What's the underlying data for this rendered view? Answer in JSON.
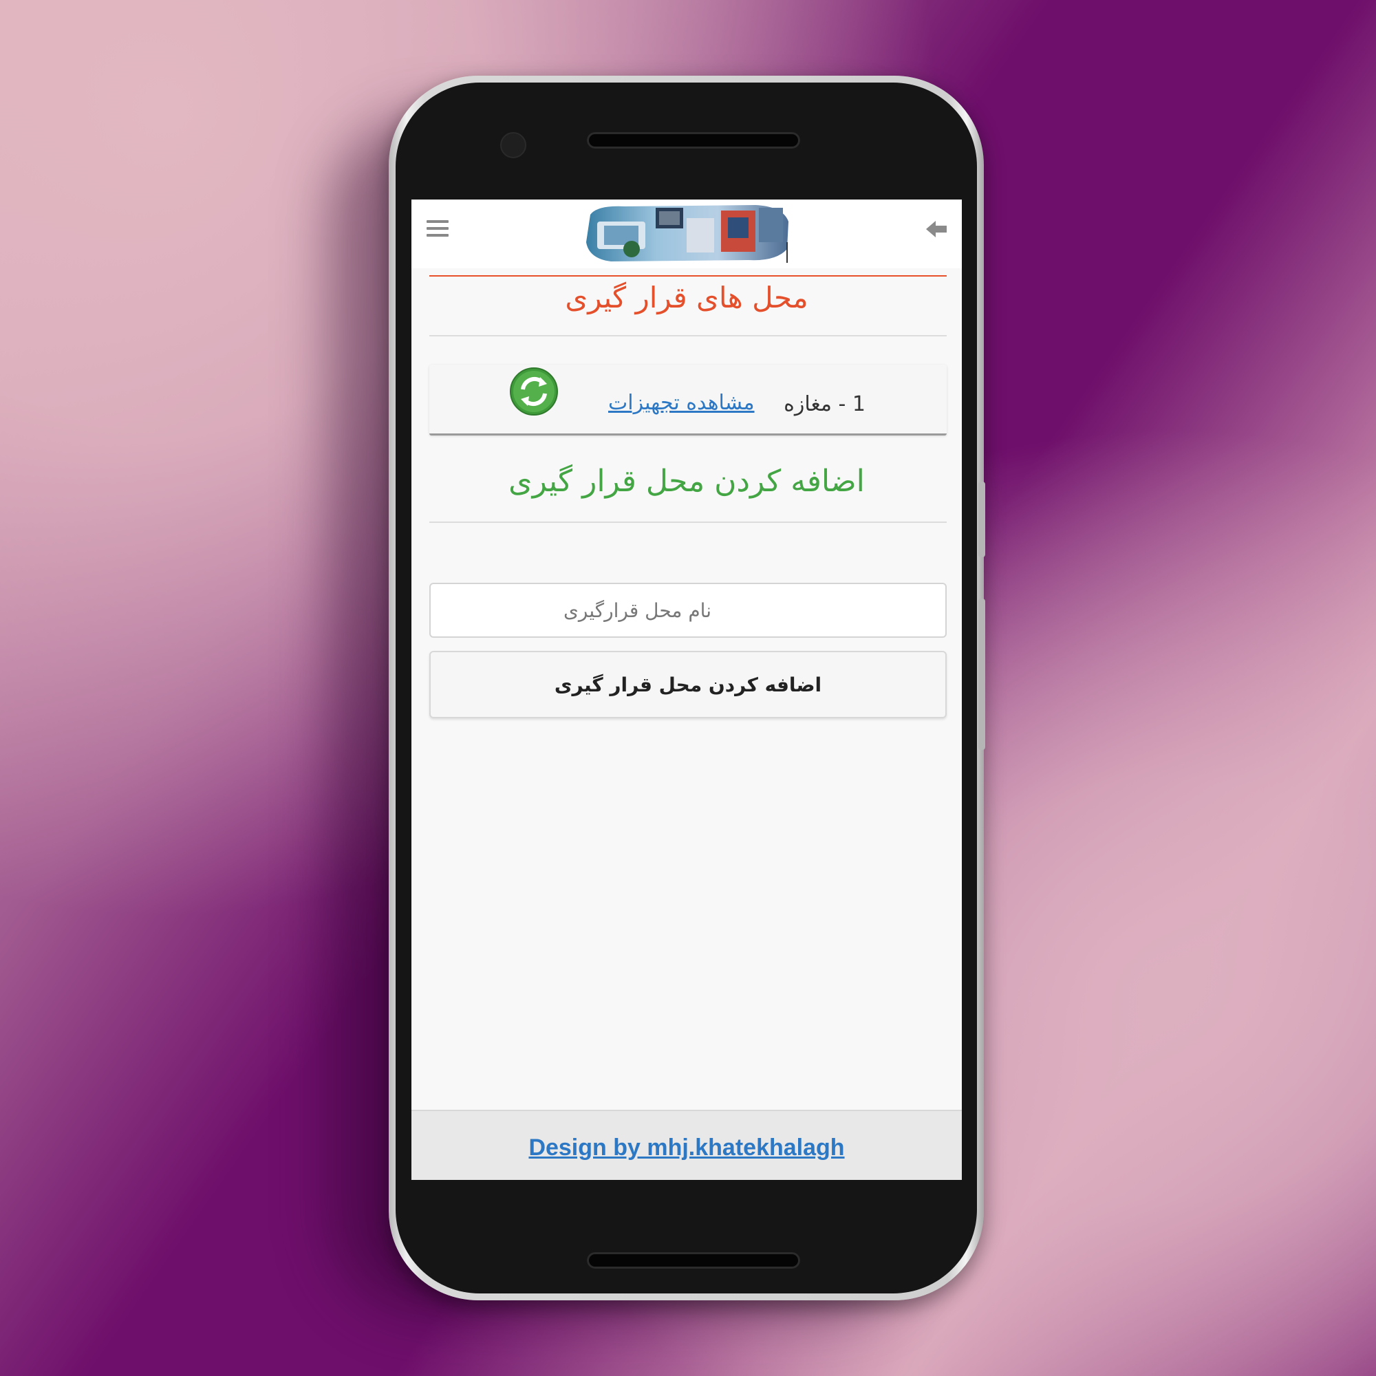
{
  "topbar": {
    "menu_icon": "hamburger-menu-icon",
    "back_icon": "back-arrow-icon",
    "banner": "electronics-equipment-banner"
  },
  "page": {
    "title": "محل های قرار گیری"
  },
  "locations": [
    {
      "label": "1 - مغازه",
      "link_text": "مشاهده تجهیزات",
      "icon": "refresh-icon"
    }
  ],
  "add_section": {
    "title": "اضافه کردن محل قرار گیری",
    "input_placeholder": "نام محل قرارگیری",
    "button_label": "اضافه کردن محل قرار گیری"
  },
  "footer": {
    "link_text": "Design by mhj.khatekhalagh"
  },
  "colors": {
    "title_red": "#e4502c",
    "section_green": "#43a543",
    "link_blue": "#2d78c4",
    "background_purple": "#6e0f6b"
  }
}
